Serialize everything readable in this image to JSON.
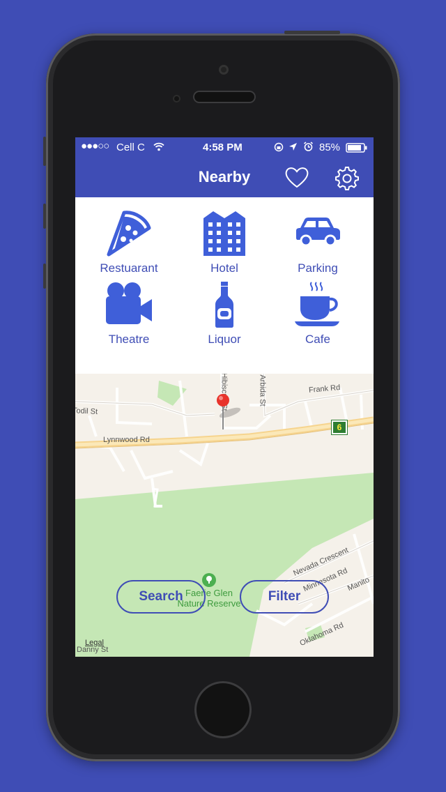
{
  "status": {
    "carrier": "Cell C",
    "time": "4:58 PM",
    "battery": "85%"
  },
  "nav": {
    "title": "Nearby",
    "favorite_icon": "heart-icon",
    "settings_icon": "gear-icon"
  },
  "categories": [
    {
      "label": "Restuarant",
      "icon": "pizza-icon"
    },
    {
      "label": "Hotel",
      "icon": "hotel-building-icon"
    },
    {
      "label": "Parking",
      "icon": "car-icon"
    },
    {
      "label": "Theatre",
      "icon": "film-camera-icon"
    },
    {
      "label": "Liquor",
      "icon": "bottle-icon"
    },
    {
      "label": "Cafe",
      "icon": "coffee-cup-icon"
    }
  ],
  "map": {
    "streets": {
      "frank": "Frank Rd",
      "todil": "Todil St",
      "lynnwood": "Lynnwood Rd",
      "hibiscus": "Hibiscus St",
      "arbida": "Arbida St",
      "nevada": "Nevada Crescent",
      "minnesota": "Minnesota Rd",
      "manitoba": "Manito",
      "oklahoma": "Oklahoma Rd",
      "danny": "Danny St"
    },
    "route_badge": "6",
    "poi": "Faerie Glen\nNature Reserve",
    "legal": "Legal"
  },
  "buttons": {
    "search": "Search",
    "filter": "Filter"
  },
  "colors": {
    "brand": "#3f4db5",
    "park": "#c5e7b5",
    "pin": "#e8332b"
  }
}
